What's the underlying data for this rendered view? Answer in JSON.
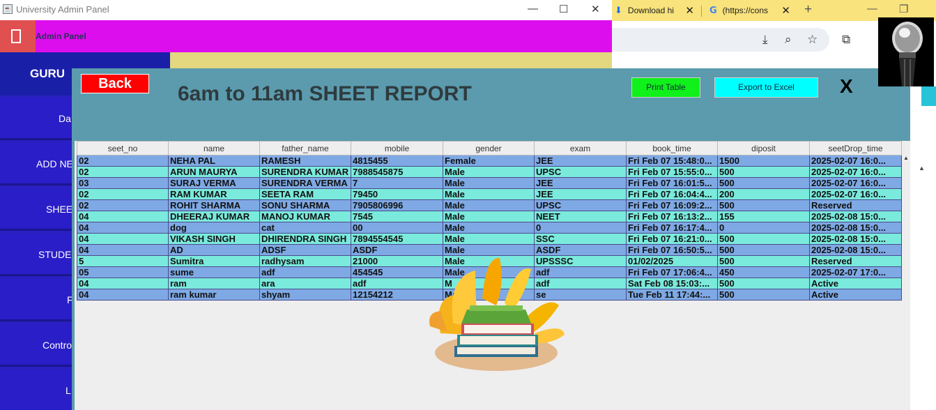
{
  "browser": {
    "tabs": [
      {
        "label": "Download hi",
        "icon": "download-icon"
      },
      {
        "label": "(https://cons",
        "icon": "google-icon"
      }
    ]
  },
  "app": {
    "window_title": "University Admin Panel",
    "header_label": "Admin Panel"
  },
  "sidebar": {
    "brand": "GURU",
    "items": [
      {
        "label": "Da"
      },
      {
        "label": "ADD NE"
      },
      {
        "label": "SHEE"
      },
      {
        "label": "STUDE"
      },
      {
        "label": "F"
      },
      {
        "label": "Contro"
      },
      {
        "label": "L"
      }
    ]
  },
  "report": {
    "back_label": "Back",
    "title": "6am to 11am SHEET REPORT",
    "print_label": "Print Table",
    "export_label": "Export to Excel",
    "close_label": "X",
    "columns": [
      "seet_no",
      "name",
      "father_name",
      "mobile",
      "gender",
      "exam",
      "book_time",
      "diposit",
      "seetDrop_time"
    ],
    "rows": [
      [
        "02",
        "NEHA PAL",
        "RAMESH",
        "4815455",
        "Female",
        "JEE",
        "Fri Feb 07 15:48:0...",
        "1500",
        "2025-02-07 16:0..."
      ],
      [
        "02",
        "ARUN MAURYA",
        "SURENDRA KUMAR",
        "7988545875",
        "Male",
        "UPSC",
        "Fri Feb 07 15:55:0...",
        "500",
        "2025-02-07 16:0..."
      ],
      [
        "03",
        "SURAJ VERMA",
        "SURENDRA VERMA",
        "7",
        "Male",
        "JEE",
        "Fri Feb 07 16:01:5...",
        "500",
        "2025-02-07 16:0..."
      ],
      [
        "02",
        "RAM KUMAR",
        "SEETA RAM",
        "79450",
        "Male",
        "JEE",
        "Fri Feb 07 16:04:4...",
        "200",
        "2025-02-07 16:0..."
      ],
      [
        "02",
        "ROHIT SHARMA",
        "SONU SHARMA",
        "7905806996",
        "Male",
        "UPSC",
        "Fri Feb 07 16:09:2...",
        "500",
        "Reserved"
      ],
      [
        "04",
        "DHEERAJ KUMAR",
        "MANOJ KUMAR",
        "7545",
        "Male",
        "NEET",
        "Fri Feb 07 16:13:2...",
        "155",
        "2025-02-08 15:0..."
      ],
      [
        "04",
        "dog",
        "cat",
        "00",
        "Male",
        "0",
        "Fri Feb 07 16:17:4...",
        "0",
        "2025-02-08 15:0..."
      ],
      [
        "04",
        "VIKASH SINGH",
        "DHIRENDRA SINGH",
        "7894554545",
        "Male",
        "SSC",
        "Fri Feb 07 16:21:0...",
        "500",
        "2025-02-08 15:0..."
      ],
      [
        "04",
        "AD",
        "ADSF",
        "ASDF",
        "Male",
        "ASDF",
        "Fri Feb 07 16:50:5...",
        "500",
        "2025-02-08 15:0..."
      ],
      [
        "5",
        "Sumitra",
        "radhysam",
        "21000",
        "Male",
        "UPSSSC",
        "01/02/2025",
        "500",
        "Reserved"
      ],
      [
        "05",
        "sume",
        "adf",
        "454545",
        "Male",
        "adf",
        "Fri Feb 07 17:06:4...",
        "450",
        "2025-02-07 17:0..."
      ],
      [
        "04",
        "ram",
        "ara",
        "adf",
        "M",
        "adf",
        "Sat Feb 08 15:03:...",
        "500",
        "Active"
      ],
      [
        "04",
        "ram kumar",
        "shyam",
        "12154212",
        "Ma",
        "se",
        "Tue Feb 11 17:44:...",
        "500",
        "Active"
      ]
    ]
  }
}
